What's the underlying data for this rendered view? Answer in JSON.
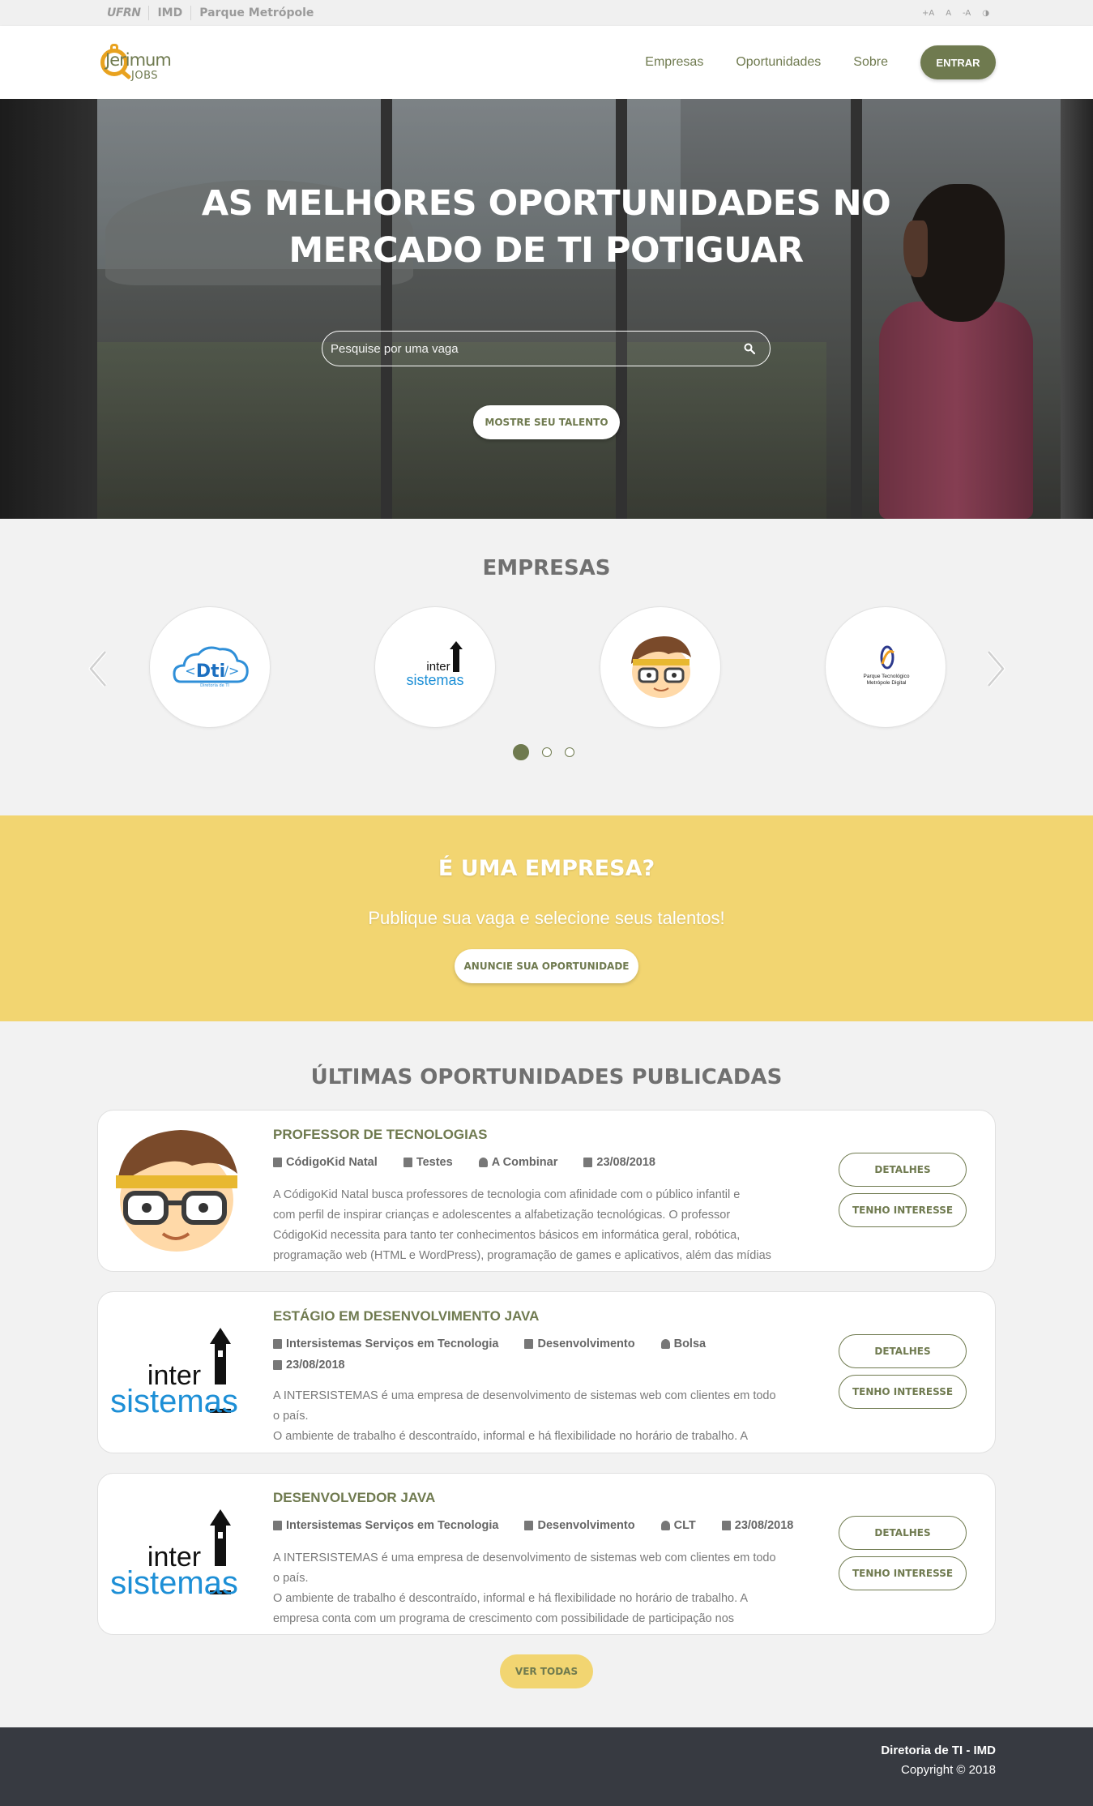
{
  "topbar": {
    "links": [
      "UFRN",
      "IMD",
      "Parque Metrópole"
    ],
    "accessibility": [
      "+A",
      "A",
      "-A",
      "◑"
    ]
  },
  "header": {
    "logo_name": "Jerimum",
    "logo_sub": "JOBS",
    "nav": [
      "Empresas",
      "Oportunidades",
      "Sobre"
    ],
    "enter_label": "ENTRAR"
  },
  "hero": {
    "title": "AS MELHORES OPORTUNIDADES NO MERCADO DE TI POTIGUAR",
    "search_placeholder": "Pesquise por uma vaga",
    "talent_button": "MOSTRE SEU TALENTO"
  },
  "empresas": {
    "title": "EMPRESAS",
    "logos": [
      {
        "name": "Dti",
        "caption": "Diretoria de TI"
      },
      {
        "name": "inter sistemas"
      },
      {
        "name": "CódigoKid"
      },
      {
        "name": "Parque Tecnológico Metrópole Digital"
      }
    ]
  },
  "band": {
    "title": "É UMA EMPRESA?",
    "subtitle": "Publique sua vaga e selecione seus talentos!",
    "button": "ANUNCIE SUA OPORTUNIDADE"
  },
  "latest": {
    "title": "ÚLTIMAS OPORTUNIDADES PUBLICADAS",
    "details_label": "DETALHES",
    "interest_label": "TENHO INTERESSE",
    "jobs": [
      {
        "title": "PROFESSOR DE TECNOLOGIAS",
        "company": "CódigoKid Natal",
        "area": "Testes",
        "contract": "A Combinar",
        "date": "23/08/2018",
        "desc": [
          "A CódigoKid Natal busca professores de tecnologia com afinidade com o público infantil e",
          "com perfil de inspirar crianças e adolescentes a alfabetização tecnológicas. O professor",
          "CódigoKid necessita para tanto ter conhecimentos básicos em informática geral, robótica,",
          "programação web (HTML e WordPress), programação de games e aplicativos, além das mídias"
        ]
      },
      {
        "title": "ESTÁGIO EM DESENVOLVIMENTO JAVA",
        "company": "Intersistemas Serviços em Tecnologia",
        "area": "Desenvolvimento",
        "contract": "Bolsa",
        "date": "23/08/2018",
        "desc": [
          "A INTERSISTEMAS é uma empresa de desenvolvimento de sistemas web com clientes em todo",
          "o país.",
          "O ambiente de trabalho é descontraído, informal e há flexibilidade no horário de trabalho. A"
        ]
      },
      {
        "title": "DESENVOLVEDOR JAVA",
        "company": "Intersistemas Serviços em Tecnologia",
        "area": "Desenvolvimento",
        "contract": "CLT",
        "date": "23/08/2018",
        "desc": [
          "A INTERSISTEMAS é uma empresa de desenvolvimento de sistemas web com clientes em todo",
          "o país.",
          "O ambiente de trabalho é descontraído, informal e há flexibilidade no horário de trabalho. A",
          "empresa conta com um programa de crescimento com possibilidade de participação nos"
        ]
      }
    ],
    "ver_todas": "VER TODAS"
  },
  "footer": {
    "line1": "Diretoria de TI - IMD",
    "line2": "Copyright © 2018"
  },
  "colors": {
    "primary": "#6f7a4f",
    "accent_yellow": "#f2d571",
    "footer_bg": "#373a41",
    "logo_orange": "#e8a21f"
  }
}
